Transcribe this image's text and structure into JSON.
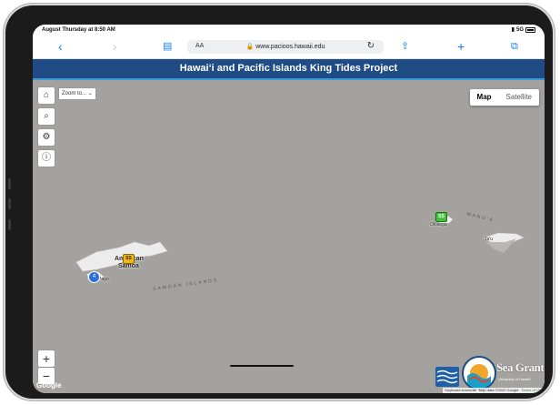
{
  "status": {
    "time": "August Thursday at 8:50 AM",
    "network": "5G"
  },
  "toolbar": {
    "back_icon": "chevron-left-icon",
    "forward_icon": "chevron-right-icon",
    "bookmarks_icon": "book-icon",
    "share_icon": "share-icon",
    "add_icon": "plus-icon",
    "tabs_icon": "tabs-icon",
    "reader_label": "AA",
    "url": "www.pacioos.hawaii.edu"
  },
  "site": {
    "title": "Hawaiʻi and Pacific Islands King Tides Project",
    "header_color": "#1f4c85"
  },
  "map": {
    "zoom_select": "Zoom to...",
    "map_type": {
      "map": "Map",
      "satellite": "Satellite",
      "active": "Map"
    },
    "controls": [
      "home-icon",
      "search-icon",
      "gear-icon",
      "info-icon"
    ],
    "zoom_in": "+",
    "zoom_out": "−",
    "labels": {
      "american_samoa_1": "American",
      "american_samoa_2": "Samoa",
      "samoan_islands": "SAMOAN ISLANDS",
      "manua": "MANU'A",
      "pago": "Pago",
      "tau": "Ta'u",
      "olosega": "Olosega"
    },
    "markers": {
      "yellow": "SS",
      "green": "SS",
      "cluster": "4"
    },
    "google": "Google",
    "attribution": [
      "Keyboard shortcuts",
      "Map data ©2022 Google",
      "Terms of Use"
    ]
  },
  "logos": {
    "seagrant_1": "Sea Grant",
    "seagrant_2": "University of Hawai'i"
  }
}
